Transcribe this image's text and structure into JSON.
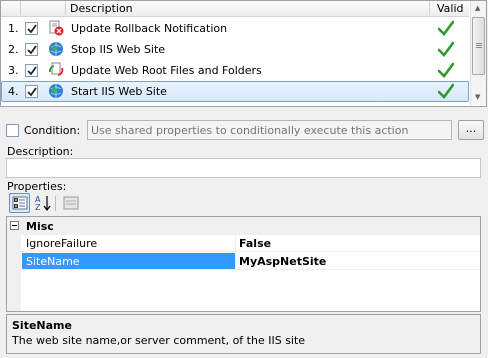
{
  "list": {
    "header": {
      "description": "Description",
      "valid": "Valid"
    },
    "rows": [
      {
        "num": "1.",
        "checked": true,
        "label": "Update Rollback Notification",
        "icon": "rollback-notification-icon",
        "valid": true
      },
      {
        "num": "2.",
        "checked": true,
        "label": "Stop IIS Web Site",
        "icon": "iis-stop-icon",
        "valid": true
      },
      {
        "num": "3.",
        "checked": true,
        "label": "Update Web Root Files and Folders",
        "icon": "file-update-icon",
        "valid": true
      },
      {
        "num": "4.",
        "checked": true,
        "label": "Start IIS Web Site",
        "icon": "iis-start-icon",
        "valid": true,
        "selected": true
      }
    ]
  },
  "condition": {
    "label": "Condition:",
    "checked": false,
    "placeholder": "Use shared properties to conditionally execute this action",
    "browse_label": "..."
  },
  "description": {
    "label": "Description:",
    "value": ""
  },
  "properties": {
    "label": "Properties:",
    "toolbar": [
      "categorized-view-icon",
      "alphabetical-sort-icon",
      "property-pages-icon"
    ],
    "category": "Misc",
    "rows": [
      {
        "name": "IgnoreFailure",
        "value": "False",
        "selected": false
      },
      {
        "name": "SiteName",
        "value": "MyAspNetSite",
        "selected": true
      }
    ]
  },
  "help": {
    "title": "SiteName",
    "text": "The web site name,or server comment, of the IIS site"
  },
  "colors": {
    "selection": "#3399ff",
    "valid_check": "#2f9a2f"
  }
}
